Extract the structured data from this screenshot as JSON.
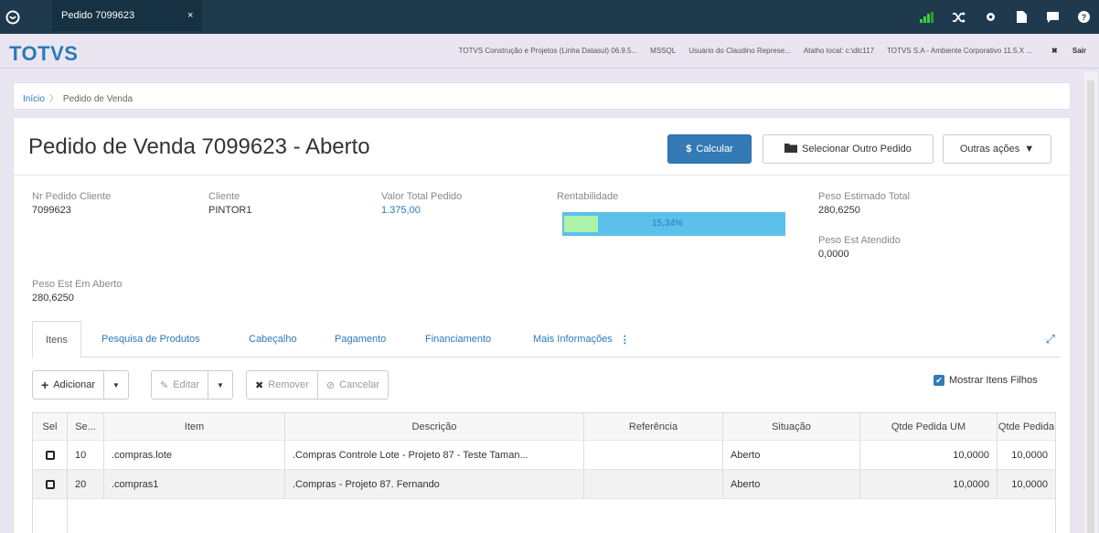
{
  "topbar": {
    "tab_label": "Pedido 7099623",
    "tab_close": "×"
  },
  "appbar": {
    "brand": "TOTVS",
    "company": "TOTVS Construção e Projetos (Linha Datasul) 06.9.5...",
    "db": "MSSQL",
    "user": "Usuário do Claudino Represe...",
    "shortcut": "Atalho local: c:\\dlc117",
    "environment": "TOTVS S.A - Ambiente Corporativo 11.5.X ...",
    "logout": "Sair"
  },
  "breadcrumb": {
    "home": "Início",
    "current": "Pedido de Venda"
  },
  "page": {
    "title": "Pedido de Venda 7099623 - Aberto",
    "calc_button": "Calcular",
    "select_button": "Selecionar Outro Pedido",
    "actions_button": "Outras ações"
  },
  "fields": {
    "nr_pedido_label": "Nr Pedido Cliente",
    "nr_pedido_value": "7099623",
    "cliente_label": "Cliente",
    "cliente_value": "PINTOR1",
    "valor_label": "Valor Total Pedido",
    "valor_value": "1.375,00",
    "rent_label": "Rentabilidade",
    "rent_value": "15,34%",
    "rent_fraction": 0.1534,
    "peso_total_label": "Peso Estimado Total",
    "peso_total_value": "280,6250",
    "peso_atendido_label": "Peso Est Atendido",
    "peso_atendido_value": "0,0000",
    "peso_aberto_label": "Peso Est Em Aberto",
    "peso_aberto_value": "280,6250"
  },
  "tabs": [
    "Itens",
    "Pesquisa de Produtos",
    "Cabeçalho",
    "Pagamento",
    "Financiamento",
    "Mais Informações"
  ],
  "toolbar": {
    "add": "Adicionar",
    "edit": "Editar",
    "remove": "Remover",
    "cancel": "Cancelar",
    "show_children": "Mostrar Itens Filhos"
  },
  "grid": {
    "headers": [
      "Sel",
      "Se...",
      "Item",
      "Descrição",
      "Referência",
      "Situação",
      "Qtde Pedida UM",
      "Qtde Pedida"
    ],
    "rows": [
      {
        "seq": "10",
        "item": ".compras.lote",
        "desc": ".Compras Controle Lote - Projeto 87 - Teste Taman...",
        "ref": "",
        "sit": "Aberto",
        "qtde_um": "10,0000",
        "qtde": "10,0000"
      },
      {
        "seq": "20",
        "item": ".compras1",
        "desc": ".Compras - Projeto 87. Fernando",
        "ref": "",
        "sit": "Aberto",
        "qtde_um": "10,0000",
        "qtde": "10,0000"
      }
    ]
  },
  "colors": {
    "topbar": "#1f3a4d",
    "brand": "#2a7ab8",
    "primary": "#337ab7",
    "rent_bar": "#5bc0eb",
    "rent_fill": "#aef2a8"
  }
}
